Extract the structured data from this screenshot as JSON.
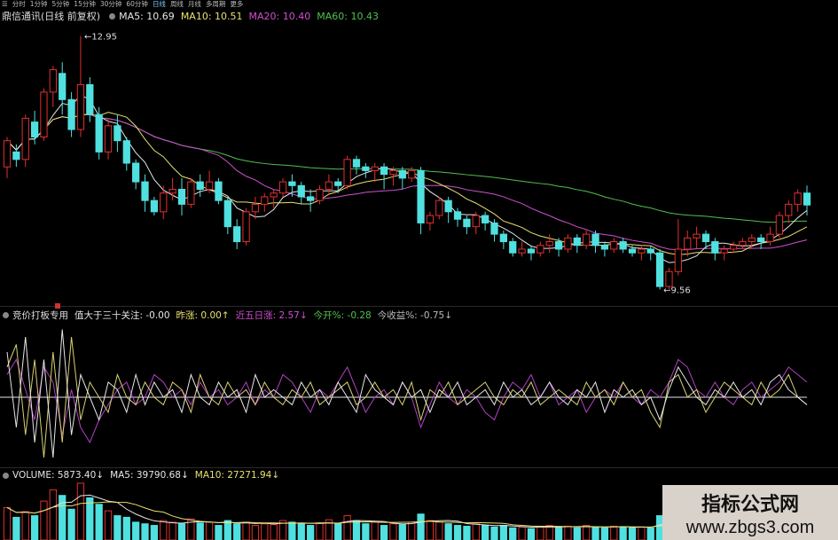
{
  "timeframes": [
    "分时",
    "1分钟",
    "5分钟",
    "15分钟",
    "30分钟",
    "60分钟",
    "日线",
    "周线",
    "月线",
    "多周期",
    "更多"
  ],
  "active_timeframe": "日线",
  "price_panel": {
    "title": "鼎信通讯(日线 前复权)",
    "ma": [
      {
        "label": "MA5: 10.69",
        "color": "#e6e6e6"
      },
      {
        "label": "MA10: 10.51",
        "color": "#e8e070"
      },
      {
        "label": "MA20: 10.40",
        "color": "#d050d0"
      },
      {
        "label": "MA60: 10.43",
        "color": "#50c050"
      }
    ],
    "high_label": "12.95",
    "low_label": "9.56"
  },
  "indicator_panel": {
    "name": "竞价打板专用",
    "items": [
      {
        "label": "值大于三十关注: -0.00",
        "color": "#e6e6e6",
        "arrow": ""
      },
      {
        "label": "昨涨: 0.00",
        "color": "#e8e070",
        "arrow": "↑"
      },
      {
        "label": "近五日涨: 2.57",
        "color": "#d050d0",
        "arrow": "↓"
      },
      {
        "label": "今开%: -0.28",
        "color": "#50c050",
        "arrow": ""
      },
      {
        "label": "今收益%: -0.75",
        "color": "#bbbbbb",
        "arrow": "↓"
      }
    ]
  },
  "volume_panel": {
    "items": [
      {
        "label": "VOLUME: 5873.40",
        "color": "#e6e6e6",
        "arrow": "↓"
      },
      {
        "label": "MA5: 39790.68",
        "color": "#e6e6e6",
        "arrow": "↓"
      },
      {
        "label": "MA10: 27271.94",
        "color": "#e8e070",
        "arrow": "↓"
      }
    ]
  },
  "watermark": {
    "title": "指标公式网",
    "url": "www.zbgs3.com"
  },
  "chart_data": {
    "type": "candlestick",
    "ylim": [
      9.4,
      13.1
    ],
    "candles": [
      [
        11.2,
        11.55,
        11.05,
        11.6
      ],
      [
        11.4,
        11.3,
        11.2,
        11.5
      ],
      [
        11.3,
        11.85,
        11.2,
        11.9
      ],
      [
        11.8,
        11.6,
        11.5,
        11.95
      ],
      [
        11.6,
        12.2,
        11.55,
        12.25
      ],
      [
        12.2,
        12.5,
        12.0,
        12.55
      ],
      [
        12.45,
        12.1,
        11.9,
        12.6
      ],
      [
        12.1,
        11.7,
        11.6,
        12.2
      ],
      [
        11.7,
        12.3,
        11.6,
        12.95
      ],
      [
        12.3,
        11.9,
        11.8,
        12.4
      ],
      [
        11.9,
        11.4,
        11.3,
        12.0
      ],
      [
        11.4,
        11.75,
        11.3,
        11.85
      ],
      [
        11.75,
        11.55,
        11.4,
        11.9
      ],
      [
        11.55,
        11.25,
        11.15,
        11.6
      ],
      [
        11.25,
        11.0,
        10.9,
        11.3
      ],
      [
        11.0,
        10.75,
        10.6,
        11.1
      ],
      [
        10.75,
        10.6,
        10.55,
        10.8
      ],
      [
        10.6,
        10.85,
        10.5,
        10.95
      ],
      [
        10.85,
        10.9,
        10.75,
        11.05
      ],
      [
        10.9,
        10.7,
        10.55,
        11.05
      ],
      [
        10.7,
        11.0,
        10.65,
        11.05
      ],
      [
        11.0,
        10.9,
        10.8,
        11.1
      ],
      [
        10.9,
        11.0,
        10.85,
        11.15
      ],
      [
        11.0,
        10.75,
        10.7,
        11.05
      ],
      [
        10.75,
        10.4,
        10.3,
        10.8
      ],
      [
        10.4,
        10.2,
        10.1,
        10.5
      ],
      [
        10.2,
        10.6,
        10.15,
        10.65
      ],
      [
        10.6,
        10.7,
        10.5,
        10.8
      ],
      [
        10.7,
        10.8,
        10.6,
        10.85
      ],
      [
        10.8,
        10.85,
        10.65,
        10.9
      ],
      [
        10.85,
        11.0,
        10.8,
        11.05
      ],
      [
        11.0,
        10.95,
        10.8,
        11.1
      ],
      [
        10.95,
        10.8,
        10.7,
        11.0
      ],
      [
        10.8,
        10.75,
        10.6,
        10.9
      ],
      [
        10.75,
        10.9,
        10.7,
        10.95
      ],
      [
        10.9,
        11.0,
        10.85,
        11.1
      ],
      [
        11.0,
        10.95,
        10.85,
        11.05
      ],
      [
        10.95,
        11.3,
        10.9,
        11.35
      ],
      [
        11.3,
        11.2,
        11.1,
        11.35
      ],
      [
        11.2,
        11.15,
        11.05,
        11.25
      ],
      [
        11.15,
        11.2,
        11.0,
        11.25
      ],
      [
        11.2,
        11.1,
        10.9,
        11.25
      ],
      [
        11.1,
        11.15,
        10.95,
        11.2
      ],
      [
        11.15,
        11.05,
        10.9,
        11.2
      ],
      [
        11.05,
        11.15,
        11.0,
        11.2
      ],
      [
        11.15,
        10.45,
        10.3,
        11.2
      ],
      [
        10.45,
        10.55,
        10.35,
        10.6
      ],
      [
        10.55,
        10.75,
        10.5,
        10.8
      ],
      [
        10.75,
        10.6,
        10.45,
        10.8
      ],
      [
        10.6,
        10.5,
        10.4,
        10.65
      ],
      [
        10.5,
        10.4,
        10.3,
        10.55
      ],
      [
        10.4,
        10.55,
        10.3,
        10.6
      ],
      [
        10.55,
        10.45,
        10.35,
        10.6
      ],
      [
        10.45,
        10.3,
        10.2,
        10.5
      ],
      [
        10.3,
        10.2,
        10.1,
        10.35
      ],
      [
        10.2,
        10.05,
        10.0,
        10.25
      ],
      [
        10.05,
        10.1,
        10.0,
        10.2
      ],
      [
        10.1,
        10.05,
        9.95,
        10.15
      ],
      [
        10.05,
        10.15,
        10.0,
        10.2
      ],
      [
        10.15,
        10.2,
        10.05,
        10.3
      ],
      [
        10.2,
        10.1,
        10.0,
        10.25
      ],
      [
        10.1,
        10.25,
        10.05,
        10.3
      ],
      [
        10.25,
        10.15,
        10.05,
        10.3
      ],
      [
        10.15,
        10.3,
        10.1,
        10.35
      ],
      [
        10.3,
        10.15,
        10.05,
        10.35
      ],
      [
        10.15,
        10.1,
        10.0,
        10.2
      ],
      [
        10.1,
        10.2,
        10.05,
        10.25
      ],
      [
        10.2,
        10.1,
        10.05,
        10.25
      ],
      [
        10.1,
        10.05,
        10.0,
        10.15
      ],
      [
        10.05,
        10.1,
        9.95,
        10.15
      ],
      [
        10.1,
        10.05,
        9.95,
        10.15
      ],
      [
        10.05,
        9.6,
        9.56,
        10.1
      ],
      [
        9.6,
        9.8,
        9.56,
        9.85
      ],
      [
        9.8,
        10.1,
        9.75,
        10.5
      ],
      [
        10.1,
        10.25,
        10.0,
        10.35
      ],
      [
        10.25,
        10.3,
        10.1,
        10.4
      ],
      [
        10.3,
        10.2,
        10.1,
        10.35
      ],
      [
        10.2,
        10.05,
        9.95,
        10.25
      ],
      [
        10.05,
        10.1,
        9.95,
        10.15
      ],
      [
        10.1,
        10.15,
        10.05,
        10.2
      ],
      [
        10.15,
        10.2,
        10.1,
        10.25
      ],
      [
        10.2,
        10.25,
        10.1,
        10.3
      ],
      [
        10.25,
        10.2,
        10.1,
        10.3
      ],
      [
        10.2,
        10.3,
        10.15,
        10.4
      ],
      [
        10.3,
        10.55,
        10.25,
        10.6
      ],
      [
        10.55,
        10.7,
        10.45,
        10.75
      ],
      [
        10.7,
        10.85,
        10.6,
        10.9
      ],
      [
        10.85,
        10.69,
        10.55,
        10.95
      ]
    ],
    "indicator": {
      "white": [
        0.6,
        -0.4,
        0.8,
        -0.6,
        0.5,
        -0.8,
        0.9,
        -0.5,
        0.3,
        0.0,
        -0.3,
        0.2,
        0.1,
        -0.2,
        0.3,
        -0.1,
        0.2,
        0.0,
        0.1,
        -0.2,
        0.3,
        0.0,
        -0.1,
        0.2,
        0.0,
        0.1,
        -0.2,
        0.3,
        0.0,
        0.1,
        0.0,
        -0.1,
        0.2,
        0.0,
        0.1,
        -0.1,
        0.2,
        0.0,
        -0.2,
        0.3,
        0.1,
        0.0,
        -0.1,
        0.2,
        0.0,
        0.1,
        -0.2,
        0.1,
        0.0,
        0.2,
        -0.1,
        0.0,
        0.1,
        -0.1,
        0.2,
        0.0,
        0.1,
        -0.1,
        0.0,
        0.2,
        0.0,
        -0.1,
        0.1,
        0.0,
        0.2,
        -0.2,
        0.1,
        0.0,
        0.1,
        -0.1,
        0.0,
        -0.3,
        0.1,
        0.4,
        0.2,
        0.0,
        -0.1,
        0.1,
        0.0,
        0.2,
        0.0,
        0.1,
        -0.1,
        0.2,
        0.3,
        0.1,
        0.0,
        -0.1
      ],
      "yellow": [
        0.4,
        0.7,
        -0.5,
        0.5,
        -0.8,
        0.6,
        -0.6,
        0.8,
        -0.3,
        0.2,
        0.0,
        -0.2,
        0.3,
        0.0,
        -0.1,
        0.2,
        0.0,
        -0.1,
        0.2,
        0.1,
        -0.2,
        0.3,
        0.0,
        -0.1,
        0.2,
        0.0,
        0.1,
        -0.1,
        0.2,
        0.0,
        -0.1,
        0.1,
        0.0,
        0.2,
        -0.1,
        0.0,
        0.1,
        0.2,
        -0.1,
        0.0,
        0.2,
        0.0,
        0.1,
        -0.1,
        0.2,
        -0.3,
        0.1,
        0.0,
        0.2,
        -0.1,
        0.0,
        0.1,
        0.2,
        0.0,
        -0.1,
        0.1,
        0.0,
        0.2,
        -0.1,
        0.0,
        0.1,
        0.0,
        -0.1,
        0.2,
        0.0,
        0.1,
        -0.1,
        0.2,
        0.0,
        0.1,
        -0.2,
        -0.4,
        0.2,
        0.3,
        0.0,
        0.1,
        -0.2,
        0.0,
        0.2,
        0.1,
        0.0,
        -0.1,
        0.2,
        0.0,
        0.1,
        0.3,
        0.0,
        -0.1
      ],
      "purple": [
        0.3,
        0.5,
        0.1,
        -0.3,
        0.4,
        0.2,
        -0.5,
        0.1,
        -0.4,
        -0.6,
        -0.3,
        -0.1,
        0.1,
        0.2,
        -0.1,
        0.0,
        0.3,
        0.2,
        0.0,
        0.1,
        -0.1,
        0.2,
        0.0,
        0.1,
        -0.1,
        0.0,
        0.2,
        -0.1,
        0.1,
        0.0,
        0.3,
        0.2,
        0.0,
        -0.2,
        0.1,
        0.0,
        0.2,
        0.4,
        0.1,
        -0.2,
        0.0,
        0.1,
        -0.1,
        0.2,
        0.0,
        -0.4,
        -0.1,
        0.2,
        0.0,
        -0.1,
        0.1,
        0.0,
        -0.2,
        -0.3,
        0.0,
        0.2,
        0.1,
        0.3,
        0.0,
        0.2,
        -0.1,
        0.0,
        0.1,
        -0.2,
        0.0,
        0.1,
        0.0,
        0.2,
        0.0,
        -0.1,
        0.1,
        0.0,
        0.2,
        0.5,
        0.4,
        0.1,
        0.0,
        0.2,
        0.0,
        -0.1,
        0.1,
        0.2,
        0.0,
        0.1,
        0.2,
        0.4,
        0.3,
        0.2
      ]
    },
    "volume": [
      40,
      28,
      35,
      30,
      48,
      62,
      55,
      38,
      70,
      52,
      44,
      36,
      30,
      28,
      22,
      20,
      18,
      24,
      22,
      20,
      26,
      21,
      22,
      18,
      24,
      20,
      22,
      18,
      20,
      19,
      24,
      22,
      20,
      18,
      21,
      25,
      20,
      30,
      24,
      20,
      22,
      18,
      20,
      19,
      22,
      32,
      24,
      22,
      20,
      18,
      17,
      20,
      18,
      16,
      18,
      15,
      16,
      14,
      17,
      18,
      16,
      17,
      15,
      18,
      16,
      15,
      17,
      16,
      15,
      16,
      15,
      30,
      26,
      34,
      28,
      24,
      22,
      18,
      17,
      16,
      18,
      17,
      16,
      18,
      24,
      26,
      28,
      22
    ]
  }
}
